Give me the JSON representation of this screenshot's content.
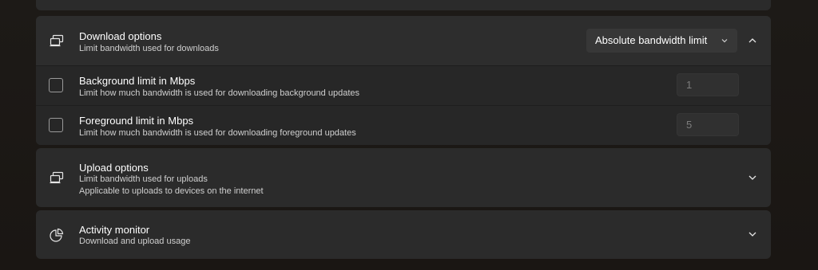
{
  "download": {
    "title": "Download options",
    "description": "Limit bandwidth used for downloads",
    "limit_mode": "Absolute bandwidth limit",
    "expanded": true,
    "background_limit": {
      "title": "Background limit in Mbps",
      "description": "Limit how much bandwidth is used for downloading background updates",
      "checked": false,
      "value": "1"
    },
    "foreground_limit": {
      "title": "Foreground limit in Mbps",
      "description": "Limit how much bandwidth is used for downloading foreground updates",
      "checked": false,
      "value": "5"
    }
  },
  "upload": {
    "title": "Upload options",
    "description_1": "Limit bandwidth used for uploads",
    "description_2": "Applicable to uploads to devices on the internet",
    "expanded": false
  },
  "activity": {
    "title": "Activity monitor",
    "description": "Download and upload usage",
    "expanded": false
  },
  "icons": {
    "download": "devices-icon",
    "upload": "devices-icon",
    "activity": "pie-chart-icon",
    "collapse": "chevron-up-icon",
    "expand": "chevron-down-icon"
  },
  "colors": {
    "card": "#2b2b2b",
    "sub_row": "#272727",
    "dropdown": "#373737",
    "background": "#1b1714"
  }
}
